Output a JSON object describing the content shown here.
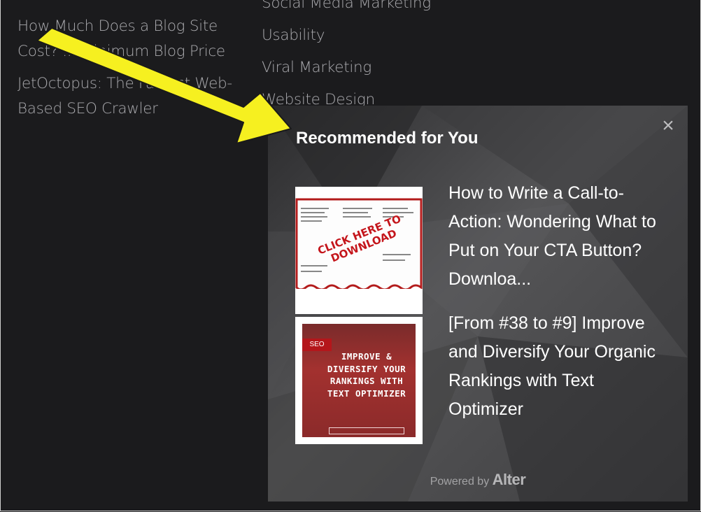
{
  "left_links": [
    "How Much Does a Blog Site Cost? ... Minimum Blog Price",
    "JetOctopus: The Fastest Web-Based SEO Crawler"
  ],
  "right_links": [
    "Social Media Marketing",
    "Usability",
    "Viral Marketing",
    "Website Design"
  ],
  "popup": {
    "title": "Recommended for You",
    "close_label": "×",
    "items": [
      {
        "title": "How to Write a Call-to-Action: Wondering What to Put on Your CTA Button? Downloa...",
        "thumb_cta": "CLICK HERE TO DOWNLOAD"
      },
      {
        "title": "[From #38 to #9] Improve and Diversify Your Organic Rankings with Text Optimizer",
        "thumb_tag": "SEO",
        "thumb_text": "IMPROVE & DIVERSIFY YOUR RANKINGS WITH TEXT OPTIMIZER"
      }
    ],
    "powered_by": "Powered by",
    "brand": "Alter"
  },
  "colors": {
    "background": "#1b1b1d",
    "link_text": "#a9a9ad",
    "arrow": "#f6f020",
    "popup_text": "#ffffff"
  }
}
